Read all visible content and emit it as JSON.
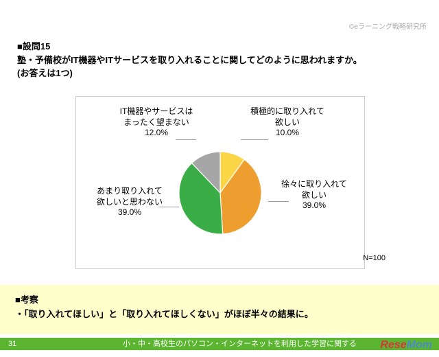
{
  "copyright": "©eラーニング戦略研究所",
  "question": {
    "title": "■設問15",
    "text": "塾・予備校がIT機器やITサービスを取り入れることに関してどのように思われますか。",
    "note": "(お答えは1つ)"
  },
  "chart_data": {
    "type": "pie",
    "title": "",
    "categories": [
      "積極的に取り入れて欲しい",
      "徐々に取り入れて欲しい",
      "あまり取り入れて欲しいと思わない",
      "IT機器やサービスはまったく望まない"
    ],
    "values": [
      10.0,
      39.0,
      39.0,
      12.0
    ],
    "colors": [
      "#FAD647",
      "#EE9E2E",
      "#3BAD46",
      "#A6A6A6"
    ],
    "labels": {
      "a": {
        "t1": "積極的に取り入れて",
        "t2": "欲しい",
        "pct": "10.0%"
      },
      "b": {
        "t1": "徐々に取り入れて",
        "t2": "欲しい",
        "pct": "39.0%"
      },
      "c": {
        "t1": "あまり取り入れて",
        "t2": "欲しいと思わない",
        "pct": "39.0%"
      },
      "d": {
        "t1": "IT機器やサービスは",
        "t2": "まったく望まない",
        "pct": "12.0%"
      }
    }
  },
  "n_label": "N=100",
  "analysis": {
    "heading": "■考察",
    "bullet": "・「取り入れてほしい」と「取り入れてほしくない」がほぼ半々の結果に。"
  },
  "footer": {
    "page": "31",
    "title": "小・中・高校生のパソコン・インターネットを利用した学習に関する"
  },
  "logo": {
    "text1": "Rese",
    "text2": "Mom"
  }
}
